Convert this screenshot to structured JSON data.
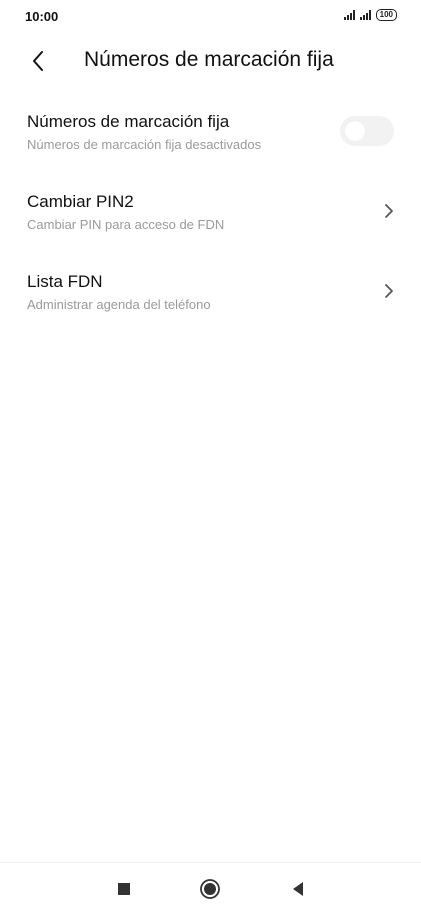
{
  "status_bar": {
    "time": "10:00",
    "battery": "100",
    "icons": [
      "signal-icon",
      "signal-icon",
      "battery-icon"
    ]
  },
  "header": {
    "title": "Números de marcación fija",
    "back_icon": "back-arrow-icon"
  },
  "settings": [
    {
      "title": "Números de marcación fija",
      "subtitle": "Números de marcación fija desactivados",
      "control": "toggle",
      "toggle_on": false
    },
    {
      "title": "Cambiar PIN2",
      "subtitle": "Cambiar PIN para acceso de FDN",
      "control": "chevron-right-icon"
    },
    {
      "title": "Lista FDN",
      "subtitle": "Administrar agenda del teléfono",
      "control": "chevron-right-icon"
    }
  ],
  "nav_bar": {
    "icons": [
      "recents-square-icon",
      "home-circle-icon",
      "back-triangle-icon"
    ]
  },
  "colors": {
    "background": "#ffffff",
    "text_primary": "#111111",
    "text_secondary": "#9a9a9a",
    "toggle_off": "#f2f2f2"
  }
}
